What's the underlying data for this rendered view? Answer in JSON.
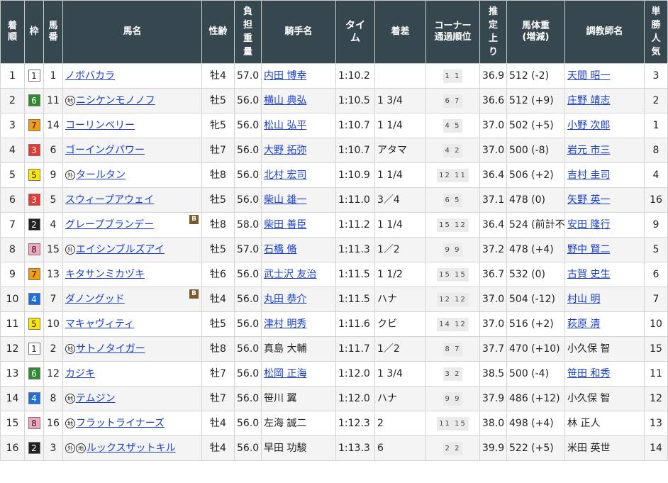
{
  "headers": {
    "rank": "着順",
    "waku": "枠",
    "umaban": "馬番",
    "horse": "馬名",
    "sexage": "性齢",
    "weight": "負担重量",
    "jockey": "騎手名",
    "time": "タイム",
    "margin": "着差",
    "corner": "コーナー通過順位",
    "last3f": "推定上り",
    "bodyweight": "馬体重(増減)",
    "trainer": "調教師名",
    "pop": "単勝人気"
  },
  "colors": {
    "header_bg": "#37474f",
    "link": "#1a3fd0",
    "waku1": "#ffffff",
    "waku2": "#222222",
    "waku3": "#e53935",
    "waku4": "#1e6fd9",
    "waku5": "#ffe600",
    "waku6": "#2e8b2e",
    "waku7": "#f39c12",
    "waku8": "#f6a6c1"
  },
  "rows": [
    {
      "rank": "1",
      "waku": "1",
      "umaban": "1",
      "marks": [],
      "horse": "ノボバカラ",
      "blinker": "",
      "sexage": "牡4",
      "weight": "57.0",
      "jockey": "内田 博幸",
      "jockey_link": true,
      "time": "1:10.2",
      "margin": "",
      "corner": "1 1",
      "last3f": "36.9",
      "bodyweight": "512 (-2)",
      "trainer": "天間 昭一",
      "trainer_link": true,
      "pop": "3"
    },
    {
      "rank": "2",
      "waku": "6",
      "umaban": "11",
      "marks": [
        "地"
      ],
      "horse": "ニシケンモノノフ",
      "blinker": "",
      "sexage": "牡5",
      "weight": "56.0",
      "jockey": "横山 典弘",
      "jockey_link": true,
      "time": "1:10.5",
      "margin": "1 3/4",
      "corner": "6 7",
      "last3f": "36.6",
      "bodyweight": "512 (+9)",
      "trainer": "庄野 靖志",
      "trainer_link": true,
      "pop": "2"
    },
    {
      "rank": "3",
      "waku": "7",
      "umaban": "14",
      "marks": [],
      "horse": "コーリンベリー",
      "blinker": "",
      "sexage": "牝5",
      "weight": "56.0",
      "jockey": "松山 弘平",
      "jockey_link": true,
      "time": "1:10.7",
      "margin": "1 1/4",
      "corner": "4 5",
      "last3f": "37.0",
      "bodyweight": "502 (+5)",
      "trainer": "小野 次郎",
      "trainer_link": true,
      "pop": "1"
    },
    {
      "rank": "4",
      "waku": "3",
      "umaban": "6",
      "marks": [],
      "horse": "ゴーイングパワー",
      "blinker": "",
      "sexage": "牡7",
      "weight": "56.0",
      "jockey": "大野 拓弥",
      "jockey_link": true,
      "time": "1:10.7",
      "margin": "アタマ",
      "corner": "4 2",
      "last3f": "37.0",
      "bodyweight": "500 (-8)",
      "trainer": "岩元 市三",
      "trainer_link": true,
      "pop": "8"
    },
    {
      "rank": "5",
      "waku": "5",
      "umaban": "9",
      "marks": [
        "外"
      ],
      "horse": "タールタン",
      "blinker": "",
      "sexage": "牡8",
      "weight": "56.0",
      "jockey": "北村 宏司",
      "jockey_link": true,
      "time": "1:10.9",
      "margin": "1 1/4",
      "corner": "12 11",
      "last3f": "36.4",
      "bodyweight": "506 (+2)",
      "trainer": "吉村 圭司",
      "trainer_link": true,
      "pop": "4"
    },
    {
      "rank": "6",
      "waku": "3",
      "umaban": "5",
      "marks": [],
      "horse": "スウィープアウェイ",
      "blinker": "",
      "sexage": "牡5",
      "weight": "56.0",
      "jockey": "柴山 雄一",
      "jockey_link": true,
      "time": "1:11.0",
      "margin": "3／4",
      "corner": "6 5",
      "last3f": "37.1",
      "bodyweight": "478 (0)",
      "trainer": "矢野 英一",
      "trainer_link": true,
      "pop": "16"
    },
    {
      "rank": "7",
      "waku": "2",
      "umaban": "4",
      "marks": [],
      "horse": "グレープブランデー",
      "blinker": "B",
      "sexage": "牡8",
      "weight": "58.0",
      "jockey": "柴田 善臣",
      "jockey_link": true,
      "time": "1:11.2",
      "margin": "1 1/4",
      "corner": "15 12",
      "last3f": "36.4",
      "bodyweight": "524 (前計不)",
      "trainer": "安田 隆行",
      "trainer_link": true,
      "pop": "9"
    },
    {
      "rank": "8",
      "waku": "8",
      "umaban": "15",
      "marks": [
        "外"
      ],
      "horse": "エイシンブルズアイ",
      "blinker": "",
      "sexage": "牡5",
      "weight": "57.0",
      "jockey": "石橋 脩",
      "jockey_link": true,
      "time": "1:11.3",
      "margin": "1／2",
      "corner": "9 9",
      "last3f": "37.2",
      "bodyweight": "478 (+4)",
      "trainer": "野中 賢二",
      "trainer_link": true,
      "pop": "5"
    },
    {
      "rank": "9",
      "waku": "7",
      "umaban": "13",
      "marks": [],
      "horse": "キタサンミカヅキ",
      "blinker": "",
      "sexage": "牡6",
      "weight": "56.0",
      "jockey": "武士沢 友治",
      "jockey_link": true,
      "time": "1:11.5",
      "margin": "1 1/2",
      "corner": "15 15",
      "last3f": "36.7",
      "bodyweight": "532 (0)",
      "trainer": "古賀 史生",
      "trainer_link": true,
      "pop": "6"
    },
    {
      "rank": "10",
      "waku": "4",
      "umaban": "7",
      "marks": [],
      "horse": "ダノングッド",
      "blinker": "B",
      "sexage": "牡4",
      "weight": "56.0",
      "jockey": "丸田 恭介",
      "jockey_link": true,
      "time": "1:11.5",
      "margin": "ハナ",
      "corner": "12 12",
      "last3f": "37.0",
      "bodyweight": "504 (-12)",
      "trainer": "村山 明",
      "trainer_link": true,
      "pop": "7"
    },
    {
      "rank": "11",
      "waku": "5",
      "umaban": "10",
      "marks": [],
      "horse": "マキャヴィティ",
      "blinker": "",
      "sexage": "牡5",
      "weight": "56.0",
      "jockey": "津村 明秀",
      "jockey_link": true,
      "time": "1:11.6",
      "margin": "クビ",
      "corner": "14 12",
      "last3f": "37.0",
      "bodyweight": "516 (+2)",
      "trainer": "萩原 清",
      "trainer_link": true,
      "pop": "10"
    },
    {
      "rank": "12",
      "waku": "1",
      "umaban": "2",
      "marks": [
        "地"
      ],
      "horse": "サトノタイガー",
      "blinker": "",
      "sexage": "牡8",
      "weight": "56.0",
      "jockey": "真島 大輔",
      "jockey_link": false,
      "time": "1:11.7",
      "margin": "1／2",
      "corner": "8 7",
      "last3f": "37.7",
      "bodyweight": "470 (+10)",
      "trainer": "小久保 智",
      "trainer_link": false,
      "pop": "15"
    },
    {
      "rank": "13",
      "waku": "6",
      "umaban": "12",
      "marks": [],
      "horse": "カジキ",
      "blinker": "",
      "sexage": "牡7",
      "weight": "56.0",
      "jockey": "松岡 正海",
      "jockey_link": true,
      "time": "1:12.0",
      "margin": "1 3/4",
      "corner": "3 2",
      "last3f": "38.5",
      "bodyweight": "500 (-4)",
      "trainer": "笹田 和秀",
      "trainer_link": true,
      "pop": "11"
    },
    {
      "rank": "14",
      "waku": "4",
      "umaban": "8",
      "marks": [
        "地"
      ],
      "horse": "テムジン",
      "blinker": "",
      "sexage": "牡7",
      "weight": "56.0",
      "jockey": "笹川 翼",
      "jockey_link": false,
      "time": "1:12.0",
      "margin": "ハナ",
      "corner": "9 9",
      "last3f": "37.9",
      "bodyweight": "486 (+12)",
      "trainer": "小久保 智",
      "trainer_link": false,
      "pop": "12"
    },
    {
      "rank": "15",
      "waku": "8",
      "umaban": "16",
      "marks": [
        "地"
      ],
      "horse": "フラットライナーズ",
      "blinker": "",
      "sexage": "牡4",
      "weight": "56.0",
      "jockey": "左海 誠二",
      "jockey_link": false,
      "time": "1:12.3",
      "margin": "2",
      "corner": "11 15",
      "last3f": "38.0",
      "bodyweight": "498 (+4)",
      "trainer": "林 正人",
      "trainer_link": false,
      "pop": "13"
    },
    {
      "rank": "16",
      "waku": "2",
      "umaban": "3",
      "marks": [
        "外",
        "地"
      ],
      "horse": "ルックスザットキル",
      "blinker": "",
      "sexage": "牡4",
      "weight": "56.0",
      "jockey": "早田 功駿",
      "jockey_link": false,
      "time": "1:13.3",
      "margin": "6",
      "corner": "2 2",
      "last3f": "39.9",
      "bodyweight": "522 (+5)",
      "trainer": "米田 英世",
      "trainer_link": false,
      "pop": "14"
    }
  ]
}
